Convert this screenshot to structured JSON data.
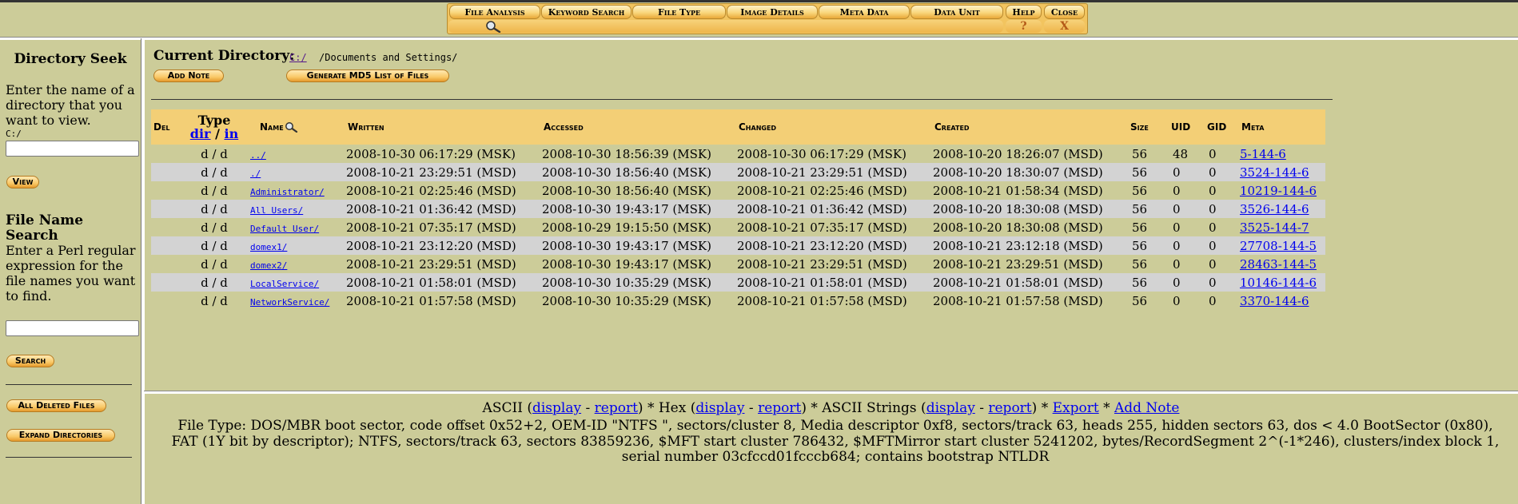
{
  "tabs": {
    "items": [
      {
        "label": "File Analysis"
      },
      {
        "label": "Keyword Search"
      },
      {
        "label": "File Type"
      },
      {
        "label": "Image Details"
      },
      {
        "label": "Meta Data"
      },
      {
        "label": "Data Unit"
      },
      {
        "label": "Help"
      },
      {
        "label": "Close"
      }
    ],
    "help_glyph": "?",
    "close_glyph": "X",
    "search_icon": "magnifier-icon"
  },
  "sidebar": {
    "dir_seek_title": "Directory Seek",
    "dir_seek_text": "Enter the name of a directory that you want to view.",
    "dir_prefix": "C:/",
    "dir_input_value": "",
    "view_button": "View",
    "file_search_title": "File Name Search",
    "file_search_text": "Enter a Perl regular expression for the file names you want to find.",
    "file_search_value": "",
    "search_button": "Search",
    "all_deleted_button": "All Deleted Files",
    "expand_dirs_button": "Expand Directories"
  },
  "main": {
    "current_dir_label": "Current Directory:",
    "current_dir_link": "C:/",
    "current_dir_path": "/Documents and Settings/",
    "add_note_button": "Add Note",
    "md5_button": "Generate MD5 List of Files"
  },
  "table": {
    "headers": {
      "del": "Del",
      "type": "Type",
      "type_dir": "dir",
      "type_sep": "/",
      "type_in": "in",
      "name": "Name",
      "written": "Written",
      "accessed": "Accessed",
      "changed": "Changed",
      "created": "Created",
      "size": "Size",
      "uid": "UID",
      "gid": "GID",
      "meta": "Meta"
    },
    "rows": [
      {
        "type": "d / d",
        "name": "../",
        "written": "2008-10-30 06:17:29 (MSK)",
        "accessed": "2008-10-30 18:56:39 (MSK)",
        "changed": "2008-10-30 06:17:29 (MSK)",
        "created": "2008-10-20 18:26:07 (MSD)",
        "size": "56",
        "uid": "48",
        "gid": "0",
        "meta": "5-144-6"
      },
      {
        "type": "d / d",
        "name": "./",
        "written": "2008-10-21 23:29:51 (MSD)",
        "accessed": "2008-10-30 18:56:40 (MSK)",
        "changed": "2008-10-21 23:29:51 (MSD)",
        "created": "2008-10-20 18:30:07 (MSD)",
        "size": "56",
        "uid": "0",
        "gid": "0",
        "meta": "3524-144-6"
      },
      {
        "type": "d / d",
        "name": "Administrator/",
        "written": "2008-10-21 02:25:46 (MSD)",
        "accessed": "2008-10-30 18:56:40 (MSK)",
        "changed": "2008-10-21 02:25:46 (MSD)",
        "created": "2008-10-21 01:58:34 (MSD)",
        "size": "56",
        "uid": "0",
        "gid": "0",
        "meta": "10219-144-6"
      },
      {
        "type": "d / d",
        "name": "All Users/",
        "written": "2008-10-21 01:36:42 (MSD)",
        "accessed": "2008-10-30 19:43:17 (MSK)",
        "changed": "2008-10-21 01:36:42 (MSD)",
        "created": "2008-10-20 18:30:08 (MSD)",
        "size": "56",
        "uid": "0",
        "gid": "0",
        "meta": "3526-144-6"
      },
      {
        "type": "d / d",
        "name": "Default User/",
        "written": "2008-10-21 07:35:17 (MSD)",
        "accessed": "2008-10-29 19:15:50 (MSK)",
        "changed": "2008-10-21 07:35:17 (MSD)",
        "created": "2008-10-20 18:30:08 (MSD)",
        "size": "56",
        "uid": "0",
        "gid": "0",
        "meta": "3525-144-7"
      },
      {
        "type": "d / d",
        "name": "domex1/",
        "written": "2008-10-21 23:12:20 (MSD)",
        "accessed": "2008-10-30 19:43:17 (MSK)",
        "changed": "2008-10-21 23:12:20 (MSD)",
        "created": "2008-10-21 23:12:18 (MSD)",
        "size": "56",
        "uid": "0",
        "gid": "0",
        "meta": "27708-144-5"
      },
      {
        "type": "d / d",
        "name": "domex2/",
        "written": "2008-10-21 23:29:51 (MSD)",
        "accessed": "2008-10-30 19:43:17 (MSK)",
        "changed": "2008-10-21 23:29:51 (MSD)",
        "created": "2008-10-21 23:29:51 (MSD)",
        "size": "56",
        "uid": "0",
        "gid": "0",
        "meta": "28463-144-5"
      },
      {
        "type": "d / d",
        "name": "LocalService/",
        "written": "2008-10-21 01:58:01 (MSD)",
        "accessed": "2008-10-30 10:35:29 (MSK)",
        "changed": "2008-10-21 01:58:01 (MSD)",
        "created": "2008-10-21 01:58:01 (MSD)",
        "size": "56",
        "uid": "0",
        "gid": "0",
        "meta": "10146-144-6"
      },
      {
        "type": "d / d",
        "name": "NetworkService/",
        "written": "2008-10-21 01:57:58 (MSD)",
        "accessed": "2008-10-30 10:35:29 (MSK)",
        "changed": "2008-10-21 01:57:58 (MSD)",
        "created": "2008-10-21 01:57:58 (MSD)",
        "size": "56",
        "uid": "0",
        "gid": "0",
        "meta": "3370-144-6"
      }
    ]
  },
  "bottom": {
    "ascii": "ASCII",
    "hex": "Hex",
    "ascii_strings": "ASCII Strings",
    "display": "display",
    "report": "report",
    "dash": "-",
    "star": "*",
    "export": "Export",
    "add_note": "Add Note",
    "file_type": "File Type: DOS/MBR boot sector, code offset 0x52+2, OEM-ID \"NTFS \", sectors/cluster 8, Media descriptor 0xf8, sectors/track 63, heads 255, hidden sectors 63, dos < 4.0 BootSector (0x80), FAT (1Y bit by descriptor); NTFS, sectors/track 63, sectors 83859236, $MFT start cluster 786432, $MFTMirror start cluster 5241202, bytes/RecordSegment 2^(-1*246), clusters/index block 1, serial number 03cfccd01fcccb684; contains bootstrap NTLDR"
  }
}
